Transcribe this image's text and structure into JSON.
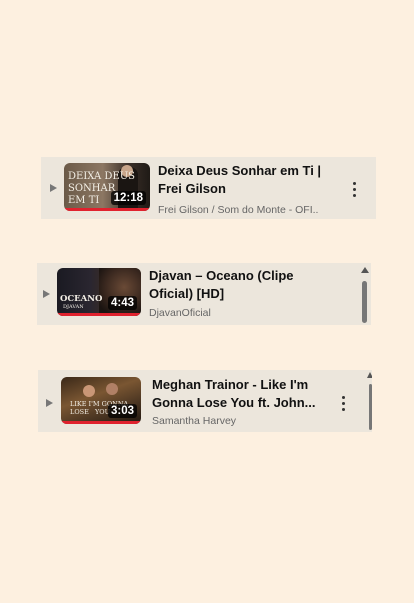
{
  "items": [
    {
      "title": "Deixa Deus Sonhar em Ti | Frei Gilson",
      "channel": "Frei Gilson / Som do Monte - OFI...",
      "duration": "12:18",
      "thumb_text": [
        "Deixa Deus",
        "Sonhar",
        "em Ti"
      ],
      "progress": 1.0
    },
    {
      "title": "Djavan – Oceano (Clipe Oficial) [HD]",
      "channel": "DjavanOficial",
      "duration": "4:43",
      "thumb_text": [
        "Oceano",
        "Djavan"
      ],
      "progress": 1.0
    },
    {
      "title": "Meghan Trainor - Like I'm Gonna Lose You ft. John...",
      "channel": "Samantha Harvey",
      "duration": "3:03",
      "thumb_text": [
        "Like I'm Gonna Lose",
        "You"
      ],
      "progress": 1.0
    }
  ],
  "icons": {
    "play": "play-triangle-icon",
    "more": "more-vertical-icon",
    "scroll_up": "scroll-up-arrow-icon"
  },
  "colors": {
    "page_bg": "#fdf0e0",
    "card_bg": "#ece6dc",
    "progress": "#e0222e"
  }
}
